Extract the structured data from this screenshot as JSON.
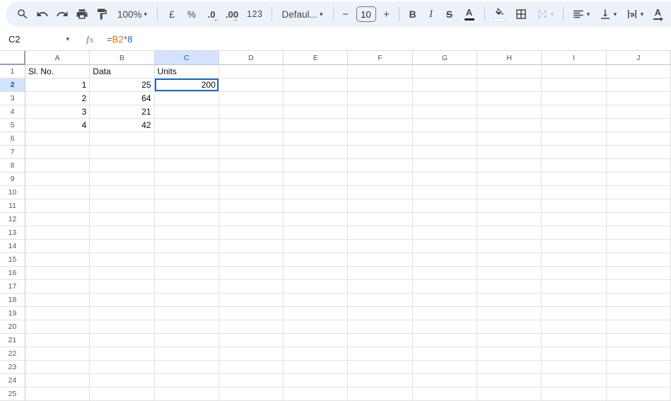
{
  "toolbar": {
    "zoom_label": "100%",
    "currency_label": "£",
    "percent_label": "%",
    "decrease_decimal_label": ".0",
    "decrease_decimal_arrow": "←",
    "increase_decimal_label": ".00",
    "increase_decimal_arrow": "→",
    "more_formats_label": "123",
    "font_label": "Defaul...",
    "decrease_font_label": "−",
    "font_size_value": "10",
    "increase_font_label": "+",
    "bold_label": "B",
    "italic_label": "I",
    "strikethrough_label": "S",
    "text_color_label": "A",
    "text_rotation_label": "A"
  },
  "formula_bar": {
    "name_box_value": "C2",
    "fx_label": "fx",
    "formula_tokens": [
      {
        "text": "=",
        "color": "#5f6368"
      },
      {
        "text": "B2",
        "color": "#e8710a"
      },
      {
        "text": "*",
        "color": "#5f6368"
      },
      {
        "text": "8",
        "color": "#1967d2"
      }
    ]
  },
  "grid": {
    "column_headers": [
      "A",
      "B",
      "C",
      "D",
      "E",
      "F",
      "G",
      "H",
      "I",
      "J"
    ],
    "row_count": 25,
    "selected_column": "C",
    "selected_row": 2,
    "selected_cell": "C2",
    "cells": [
      {
        "ref": "A1",
        "value": "Sl. No.",
        "align": "left"
      },
      {
        "ref": "B1",
        "value": "Data",
        "align": "left"
      },
      {
        "ref": "C1",
        "value": "Units",
        "align": "left"
      },
      {
        "ref": "A2",
        "value": "1",
        "align": "right"
      },
      {
        "ref": "B2",
        "value": "25",
        "align": "right"
      },
      {
        "ref": "C2",
        "value": "200",
        "align": "right"
      },
      {
        "ref": "A3",
        "value": "2",
        "align": "right"
      },
      {
        "ref": "B3",
        "value": "64",
        "align": "right"
      },
      {
        "ref": "A4",
        "value": "3",
        "align": "right"
      },
      {
        "ref": "B4",
        "value": "21",
        "align": "right"
      },
      {
        "ref": "A5",
        "value": "4",
        "align": "right"
      },
      {
        "ref": "B5",
        "value": "42",
        "align": "right"
      }
    ]
  },
  "icons": {
    "chevron_down": "▾"
  },
  "colors": {
    "selection": "#1967d2",
    "selected_header_bg": "#d3e3fd",
    "selected_header_text": "#0b57d0",
    "toolbar_bg": "#edf2fa",
    "gridline": "#e2e2e2",
    "header_text": "#575757",
    "formula_range_ref": "#e8710a",
    "formula_number": "#1967d2"
  }
}
